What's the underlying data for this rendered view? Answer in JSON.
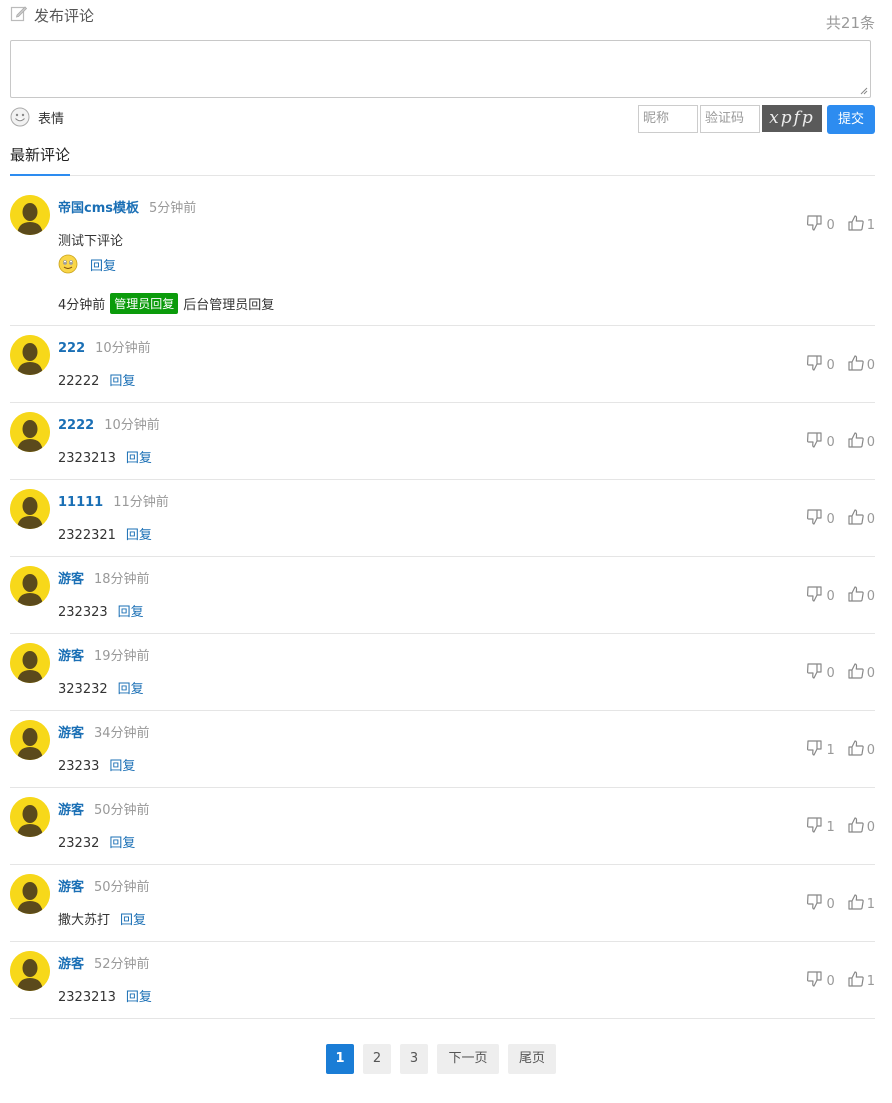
{
  "header": {
    "title": "发布评论",
    "total": "共21条"
  },
  "form": {
    "emoji_label": "表情",
    "nick_placeholder": "昵称",
    "code_placeholder": "验证码",
    "captcha_text": "xpfp",
    "submit_label": "提交"
  },
  "tabs": {
    "latest": "最新评论"
  },
  "reply_label": "回复",
  "comments": [
    {
      "user": "帝国cms模板",
      "time": "5分钟前",
      "text": "测试下评论",
      "down": "0",
      "up": "1",
      "admin_time": "4分钟前",
      "admin_badge": "管理员回复",
      "admin_text": "后台管理员回复"
    },
    {
      "user": "222",
      "time": "10分钟前",
      "text": "22222",
      "down": "0",
      "up": "0"
    },
    {
      "user": "2222",
      "time": "10分钟前",
      "text": "2323213",
      "down": "0",
      "up": "0"
    },
    {
      "user": "11111",
      "time": "11分钟前",
      "text": "2322321",
      "down": "0",
      "up": "0"
    },
    {
      "user": "游客",
      "time": "18分钟前",
      "text": "232323",
      "down": "0",
      "up": "0"
    },
    {
      "user": "游客",
      "time": "19分钟前",
      "text": "323232",
      "down": "0",
      "up": "0"
    },
    {
      "user": "游客",
      "time": "34分钟前",
      "text": "23233",
      "down": "1",
      "up": "0"
    },
    {
      "user": "游客",
      "time": "50分钟前",
      "text": "23232",
      "down": "1",
      "up": "0"
    },
    {
      "user": "游客",
      "time": "50分钟前",
      "text": "撒大苏打",
      "down": "0",
      "up": "1"
    },
    {
      "user": "游客",
      "time": "52分钟前",
      "text": "2323213",
      "down": "0",
      "up": "1"
    }
  ],
  "pager": {
    "pages": [
      "1",
      "2",
      "3"
    ],
    "next": "下一页",
    "last": "尾页"
  },
  "colors": {
    "accent": "#2d8cf0",
    "link": "#1a6fb5",
    "admin_badge": "#0b9b0b",
    "avatar": "#f7d81a"
  }
}
